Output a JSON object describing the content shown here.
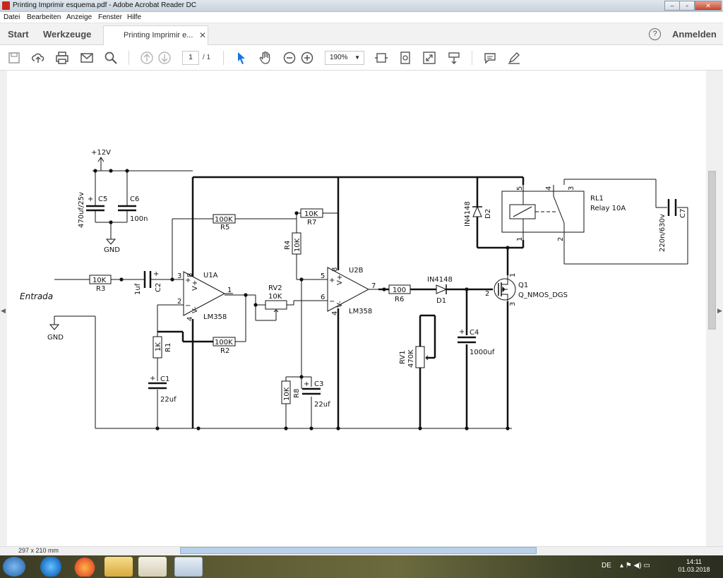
{
  "window": {
    "title": "Printing Imprimir esquema.pdf - Adobe Acrobat Reader DC",
    "min": "–",
    "max": "▫",
    "close": "✕"
  },
  "menu": [
    "Datei",
    "Bearbeiten",
    "Anzeige",
    "Fenster",
    "Hilfe"
  ],
  "tabs": {
    "start": "Start",
    "tools": "Werkzeuge",
    "doc": "Printing Imprimir e...",
    "close": "✕",
    "help": "?",
    "login": "Anmelden"
  },
  "toolbar": {
    "page_current": "1",
    "page_total": "/ 1",
    "zoom": "190%"
  },
  "status": {
    "page_size": "297 x 210 mm"
  },
  "taskbar": {
    "lang": "DE",
    "time": "14:11",
    "date": "01.03.2018"
  },
  "schematic": {
    "vcc": "+12V",
    "gnd1": "GND",
    "gnd2": "GND",
    "input": "Entrada",
    "c5_ref": "C5",
    "c5_val": "470uf/25v",
    "c6_ref": "C6",
    "c6_val": "100n",
    "r3_ref": "R3",
    "r3_val": "10K",
    "c2_ref": "C2",
    "c2_val": "1uf",
    "r5_ref": "R5",
    "r5_val": "100K",
    "r7_ref": "R7",
    "r7_val": "10K",
    "r4_ref": "R4",
    "r4_val": "10K",
    "u1a_ref": "U1A",
    "u1a_val": "LM358",
    "u2b_ref": "U2B",
    "u2b_val": "LM358",
    "rv2_ref": "RV2",
    "rv2_val": "10K",
    "r2_ref": "R2",
    "r2_val": "100K",
    "r1_ref": "R1",
    "r1_val": "1K",
    "c1_ref": "C1",
    "c1_val": "22uf",
    "r8_ref": "R8",
    "r8_val": "10K",
    "c3_ref": "C3",
    "c3_val": "22uf",
    "r6_ref": "R6",
    "r6_val": "100",
    "d1_ref": "D1",
    "d1_val": "IN4148",
    "d2_ref": "D2",
    "d2_val": "IN4148",
    "c4_ref": "C4",
    "c4_val": "1000uf",
    "rv1_ref": "RV1",
    "rv1_val": "470K",
    "q1_ref": "Q1",
    "q1_val": "Q_NMOS_DGS",
    "rl1_ref": "RL1",
    "rl1_val": "Relay 10A",
    "c7_ref": "C7",
    "c7_val": "220n/630v"
  }
}
